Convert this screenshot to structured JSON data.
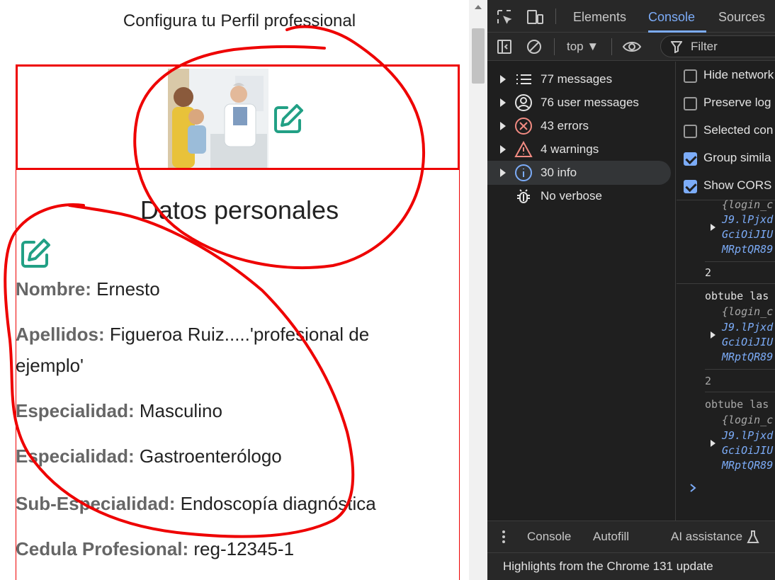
{
  "page": {
    "title": "Configura tu Perfil professional",
    "section_title": "Datos personales",
    "fields": [
      {
        "label": "Nombre:",
        "value": " Ernesto"
      },
      {
        "label": "Apellidos:",
        "value": " Figueroa Ruiz.....'profesional de"
      },
      {
        "label": "",
        "value": "ejemplo'"
      },
      {
        "label": "Especialidad:",
        "value": " Masculino"
      },
      {
        "label": "Especialidad:",
        "value": " Gastroenterólogo"
      },
      {
        "label": "Sub-Especialidad:",
        "value": " Endoscopía diagnóstica"
      },
      {
        "label": "Cedula Profesional:",
        "value": " reg-12345-1"
      }
    ],
    "icons": {
      "edit": "pencil-square-icon",
      "photo": "doctor-with-family-photo"
    },
    "colors": {
      "accent": "#22a085",
      "annotation": "#ee0000",
      "label": "#666666"
    }
  },
  "devtools": {
    "tabs": [
      "Elements",
      "Console",
      "Sources"
    ],
    "active_tab": "Console",
    "toolbar": {
      "context": "top ▼",
      "filter_placeholder": "Filter"
    },
    "sidebar": [
      {
        "label": "77 messages",
        "icon": "list-icon"
      },
      {
        "label": "76 user messages",
        "icon": "user-circle-icon"
      },
      {
        "label": "43 errors",
        "icon": "error-x-icon"
      },
      {
        "label": "4 warnings",
        "icon": "warning-triangle-icon"
      },
      {
        "label": "30 info",
        "icon": "info-icon"
      },
      {
        "label": "No verbose",
        "icon": "bug-icon"
      }
    ],
    "options": [
      {
        "label": "Hide network",
        "checked": false
      },
      {
        "label": "Preserve log",
        "checked": false
      },
      {
        "label": "Selected con",
        "checked": false
      },
      {
        "label": "Group simila",
        "checked": true
      },
      {
        "label": "Show CORS e",
        "checked": true
      }
    ],
    "log": {
      "obj_open": "{login_c",
      "line1": "J9.lPjxd",
      "line2": "GciOiJIU",
      "line3": "MRptQR89",
      "count": "2",
      "message": "obtube las"
    },
    "drawer_tabs": [
      "Console",
      "Autofill",
      "AI assistance"
    ],
    "footer": "Highlights from the Chrome 131 update"
  }
}
